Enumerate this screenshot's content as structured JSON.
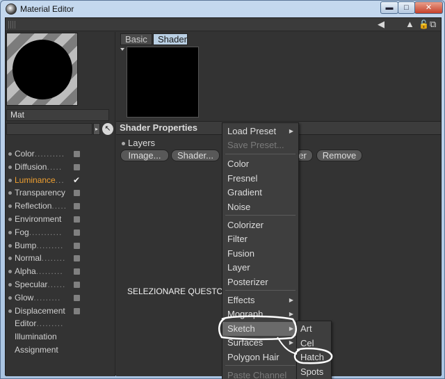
{
  "window": {
    "title": "Material Editor",
    "min_glyph": "▬",
    "max_glyph": "□",
    "close_glyph": "✕"
  },
  "toolbar": {
    "icons": [
      "back-arrow-icon",
      "up-arrow-icon",
      "lock-icon",
      "expand-icon"
    ],
    "back_glyph": "◀",
    "up_glyph": "▲",
    "lock_glyph": "🔓",
    "expand_glyph": "⧉"
  },
  "left": {
    "material_name": "Mat",
    "channels": [
      {
        "label": "Color",
        "dots": "..........",
        "has_dot": true,
        "checkbox": true
      },
      {
        "label": "Diffusion",
        "dots": ".....",
        "has_dot": true,
        "checkbox": true
      },
      {
        "label": "Luminance",
        "dots": "...",
        "has_dot": true,
        "checkbox": true,
        "active": true,
        "checked": true
      },
      {
        "label": "Transparency",
        "dots": "",
        "has_dot": true,
        "checkbox": true
      },
      {
        "label": "Reflection",
        "dots": ".....",
        "has_dot": true,
        "checkbox": true
      },
      {
        "label": "Environment",
        "dots": "",
        "has_dot": true,
        "checkbox": true
      },
      {
        "label": "Fog",
        "dots": "...........",
        "has_dot": true,
        "checkbox": true
      },
      {
        "label": "Bump",
        "dots": ".........",
        "has_dot": true,
        "checkbox": true
      },
      {
        "label": "Normal",
        "dots": "........",
        "has_dot": true,
        "checkbox": true
      },
      {
        "label": "Alpha",
        "dots": ".........",
        "has_dot": true,
        "checkbox": true
      },
      {
        "label": "Specular",
        "dots": "......",
        "has_dot": true,
        "checkbox": true
      },
      {
        "label": "Glow",
        "dots": ".........",
        "has_dot": true,
        "checkbox": true
      },
      {
        "label": "Displacement",
        "dots": "",
        "has_dot": true,
        "checkbox": true
      },
      {
        "label": "Editor",
        "dots": ".........",
        "has_dot": false,
        "checkbox": false
      },
      {
        "label": "Illumination",
        "dots": "",
        "has_dot": false,
        "checkbox": false
      },
      {
        "label": "Assignment",
        "dots": "",
        "has_dot": false,
        "checkbox": false
      }
    ]
  },
  "right": {
    "tabs": [
      {
        "label": "Basic"
      },
      {
        "label": "Shader"
      }
    ],
    "section_title": "Shader Properties",
    "layers_label": "Layers",
    "buttons": {
      "image": "Image...",
      "shader": "Shader...",
      "folder": "er",
      "remove": "Remove"
    },
    "annotation": "SELEZIONARE QUESTO"
  },
  "menu": {
    "items": [
      {
        "label": "Load Preset",
        "submenu": true,
        "disabled": false
      },
      {
        "label": "Save Preset...",
        "submenu": false,
        "disabled": true
      },
      {
        "label": "Color",
        "submenu": false,
        "disabled": false
      },
      {
        "label": "Fresnel",
        "submenu": false,
        "disabled": false
      },
      {
        "label": "Gradient",
        "submenu": false,
        "disabled": false
      },
      {
        "label": "Noise",
        "submenu": false,
        "disabled": false
      },
      {
        "label": "Colorizer",
        "submenu": false,
        "disabled": false
      },
      {
        "label": "Filter",
        "submenu": false,
        "disabled": false
      },
      {
        "label": "Fusion",
        "submenu": false,
        "disabled": false
      },
      {
        "label": "Layer",
        "submenu": false,
        "disabled": false
      },
      {
        "label": "Posterizer",
        "submenu": false,
        "disabled": false
      },
      {
        "label": "Effects",
        "submenu": true,
        "disabled": false
      },
      {
        "label": "Mograph",
        "submenu": true,
        "disabled": false
      },
      {
        "label": "Sketch",
        "submenu": true,
        "disabled": false,
        "highlighted": true
      },
      {
        "label": "Surfaces",
        "submenu": true,
        "disabled": false
      },
      {
        "label": "Polygon Hair",
        "submenu": false,
        "disabled": false
      },
      {
        "label": "Paste Channel",
        "submenu": false,
        "disabled": true
      }
    ],
    "submenu_glyph": "▶"
  },
  "submenu": {
    "items": [
      {
        "label": "Art"
      },
      {
        "label": "Cel"
      },
      {
        "label": "Hatch"
      },
      {
        "label": "Spots"
      }
    ]
  }
}
